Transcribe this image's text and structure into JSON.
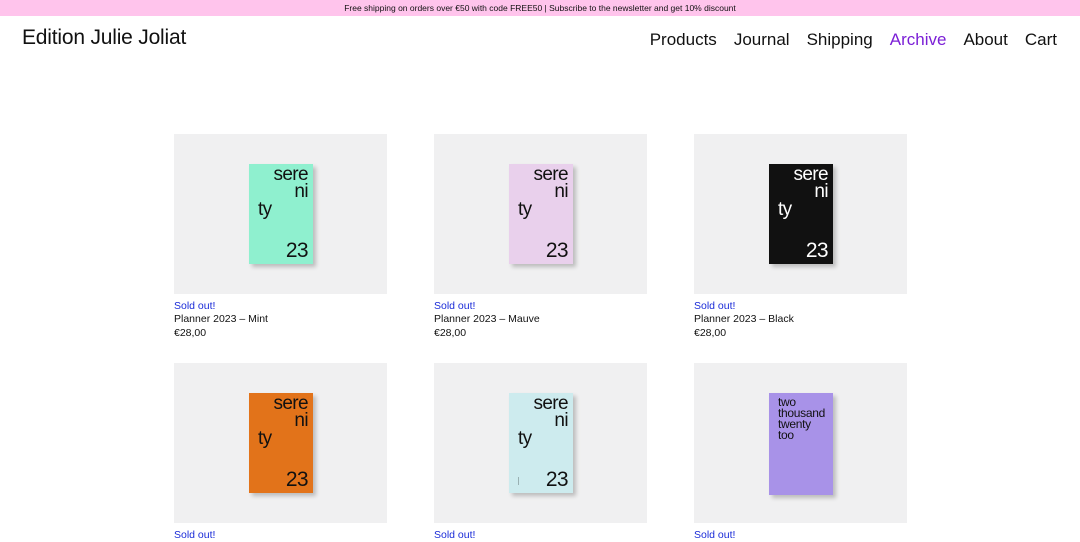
{
  "promo": {
    "text": "Free shipping on orders over €50 with code FREE50 | Subscribe to the newsletter and get 10% discount",
    "color": "#ffc4ec"
  },
  "header": {
    "brand": "Edition Julie Joliat",
    "nav": [
      {
        "label": "Products",
        "active": false
      },
      {
        "label": "Journal",
        "active": false
      },
      {
        "label": "Shipping",
        "active": false
      },
      {
        "label": "Archive",
        "active": true
      },
      {
        "label": "About",
        "active": false
      },
      {
        "label": "Cart",
        "active": false
      }
    ],
    "active_color": "#7b1fd6"
  },
  "products": [
    {
      "status": "Sold out!",
      "name": "Planner 2023 – Mint",
      "price": "€28,00",
      "cover": {
        "color": "#8ff0cf",
        "text_color": "#111",
        "lines": [
          "sere",
          "ni",
          "ty",
          "23"
        ]
      }
    },
    {
      "status": "Sold out!",
      "name": "Planner 2023 – Mauve",
      "price": "€28,00",
      "cover": {
        "color": "#e9d0ec",
        "text_color": "#111",
        "lines": [
          "sere",
          "ni",
          "ty",
          "23"
        ]
      }
    },
    {
      "status": "Sold out!",
      "name": "Planner 2023 – Black",
      "price": "€28,00",
      "cover": {
        "color": "#111111",
        "text_color": "#ffffff",
        "lines": [
          "sere",
          "ni",
          "ty",
          "23"
        ]
      }
    },
    {
      "status": "Sold out!",
      "name": "",
      "price": "",
      "cover": {
        "color": "#e2731a",
        "text_color": "#111",
        "lines": [
          "sere",
          "ni",
          "ty",
          "23"
        ]
      }
    },
    {
      "status": "Sold out!",
      "name": "",
      "price": "",
      "cover": {
        "color": "#cdebee",
        "text_color": "#111",
        "lines": [
          "sere",
          "ni",
          "ty",
          "23"
        ]
      }
    },
    {
      "status": "Sold out!",
      "name": "",
      "price": "",
      "cover": {
        "color": "#a892e8",
        "text_color": "#111",
        "lines": [
          "two",
          "thousand",
          "twenty",
          "too"
        ]
      }
    }
  ],
  "status_color": "#1a2bd8"
}
